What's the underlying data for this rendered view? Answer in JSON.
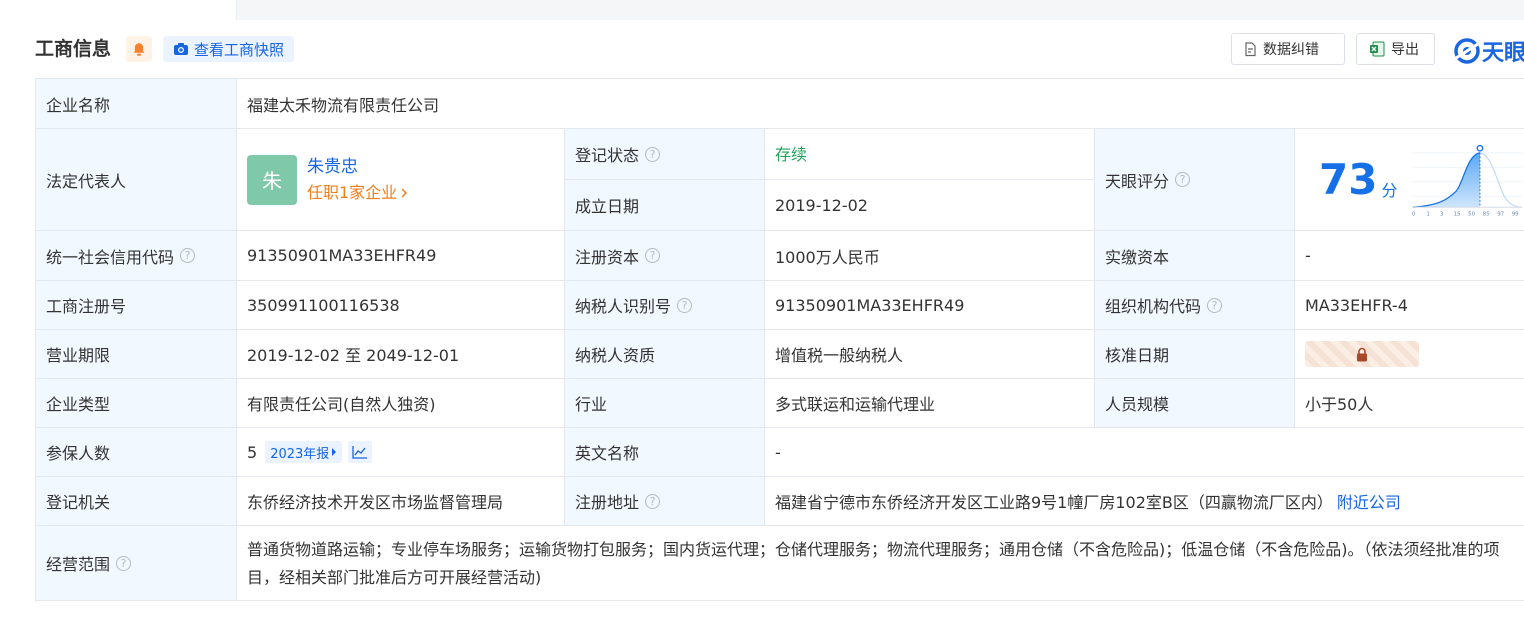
{
  "header": {
    "title": "工商信息",
    "snapshot_label": "查看工商快照",
    "correct_label": "数据纠错",
    "export_label": "导出",
    "logo_text": "天眼"
  },
  "info": {
    "company_name_label": "企业名称",
    "company_name": "福建太禾物流有限责任公司",
    "legal_rep_label": "法定代表人",
    "legal_rep_avatar": "朱",
    "legal_rep_name": "朱贵忠",
    "legal_rep_sub": "任职1家企业",
    "reg_status_label": "登记状态",
    "reg_status": "存续",
    "found_date_label": "成立日期",
    "found_date": "2019-12-02",
    "tianyan_score_label": "天眼评分",
    "tianyan_score": "73",
    "score_unit": "分",
    "score_ticks": [
      "0",
      "1",
      "3",
      "15",
      "50",
      "85",
      "97",
      "99"
    ],
    "credit_code_label": "统一社会信用代码",
    "credit_code": "91350901MA33EHFR49",
    "reg_capital_label": "注册资本",
    "reg_capital": "1000万人民币",
    "paid_capital_label": "实缴资本",
    "paid_capital": "-",
    "reg_no_label": "工商注册号",
    "reg_no": "350991100116538",
    "taxpayer_id_label": "纳税人识别号",
    "taxpayer_id": "91350901MA33EHFR49",
    "org_code_label": "组织机构代码",
    "org_code": "MA33EHFR-4",
    "biz_term_label": "营业期限",
    "biz_term": "2019-12-02 至 2049-12-01",
    "taxpayer_qual_label": "纳税人资质",
    "taxpayer_qual": "增值税一般纳税人",
    "approve_date_label": "核准日期",
    "company_type_label": "企业类型",
    "company_type": "有限责任公司(自然人独资)",
    "industry_label": "行业",
    "industry": "多式联运和运输代理业",
    "staff_size_label": "人员规模",
    "staff_size": "小于50人",
    "insured_label": "参保人数",
    "insured": "5",
    "insured_year": "2023年报",
    "english_name_label": "英文名称",
    "english_name": "-",
    "reg_authority_label": "登记机关",
    "reg_authority": "东侨经济技术开发区市场监督管理局",
    "reg_address_label": "注册地址",
    "reg_address": "福建省宁德市东侨经济开发区工业路9号1幢厂房102室B区（四赢物流厂区内）",
    "nearby_label": "附近公司",
    "scope_label": "经营范围",
    "scope": "普通货物道路运输；专业停车场服务；运输货物打包服务；国内货运代理；仓储代理服务；物流代理服务；通用仓储（不含危险品)；低温仓储（不含危险品)。（依法须经批准的项目，经相关部门批准后方可开展经营活动)"
  },
  "colors": {
    "label_bg": "#f2f8ff",
    "link": "#1565e0",
    "status_green": "#20a35a",
    "accent_orange": "#f07e1e",
    "score_blue": "#1570e8"
  }
}
